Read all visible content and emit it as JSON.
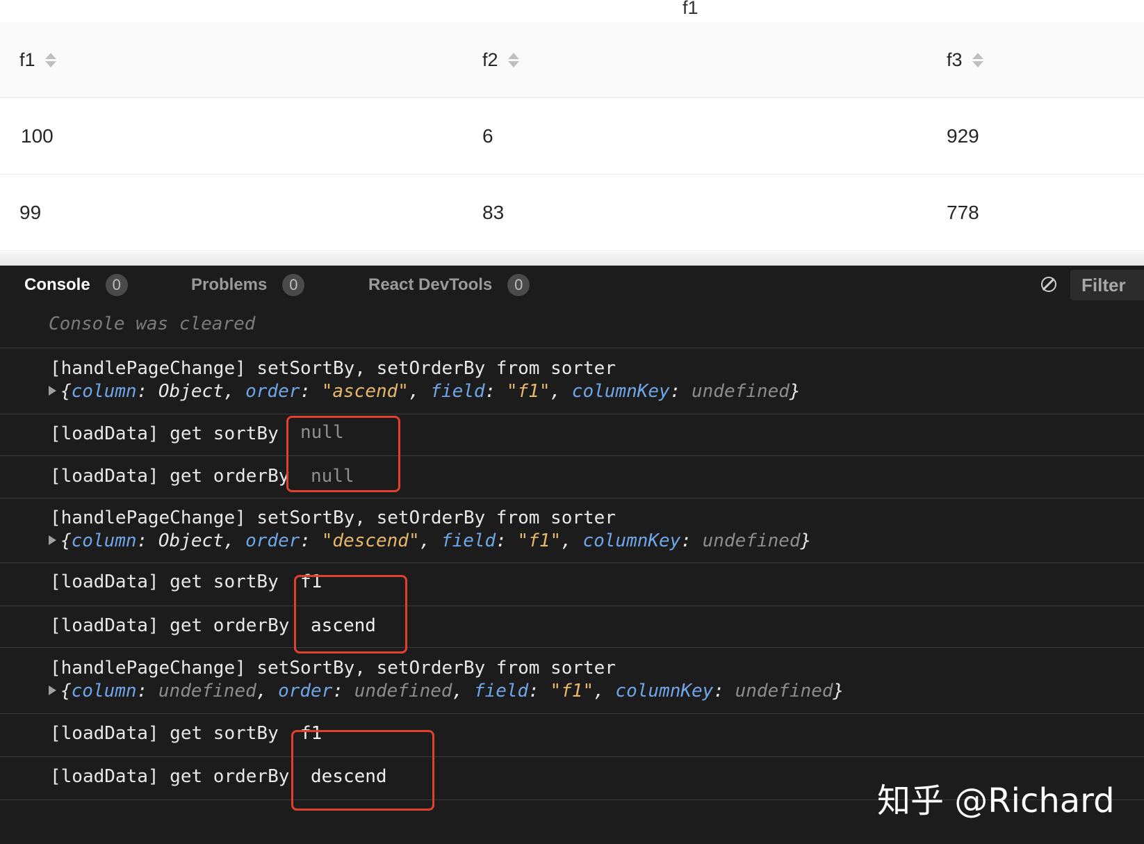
{
  "top_label": "f1",
  "table": {
    "columns": [
      "f1",
      "f2",
      "f3"
    ],
    "rows": [
      [
        "100",
        "6",
        "929"
      ],
      [
        "99",
        "83",
        "778"
      ]
    ]
  },
  "devtools": {
    "tabs": [
      {
        "label": "Console",
        "count": "0"
      },
      {
        "label": "Problems",
        "count": "0"
      },
      {
        "label": "React DevTools",
        "count": "0"
      }
    ],
    "filter_label": "Filter",
    "cleared_message": "Console was cleared",
    "log": {
      "handle_msg": "[handlePageChange] setSortBy, setOrderBy from sorter",
      "sortby_msg": "[loadData] get sortBy",
      "orderby_msg": "[loadData] get orderBy",
      "obj_keys": {
        "column": "column",
        "order": "order",
        "field": "field",
        "columnKey": "columnKey"
      },
      "obj_values": {
        "object": "Object",
        "undefined": "undefined",
        "ascend": "\"ascend\"",
        "descend": "\"descend\"",
        "f1": "\"f1\""
      },
      "values": {
        "null": "null",
        "f1": "f1",
        "ascend": "ascend",
        "descend": "descend"
      }
    }
  },
  "watermark": "知乎 @Richard",
  "colors": {
    "highlight_box": "#e2402f",
    "key": "#6fa6e8",
    "string": "#e6b86a",
    "console_bg": "#1c1c1c"
  }
}
